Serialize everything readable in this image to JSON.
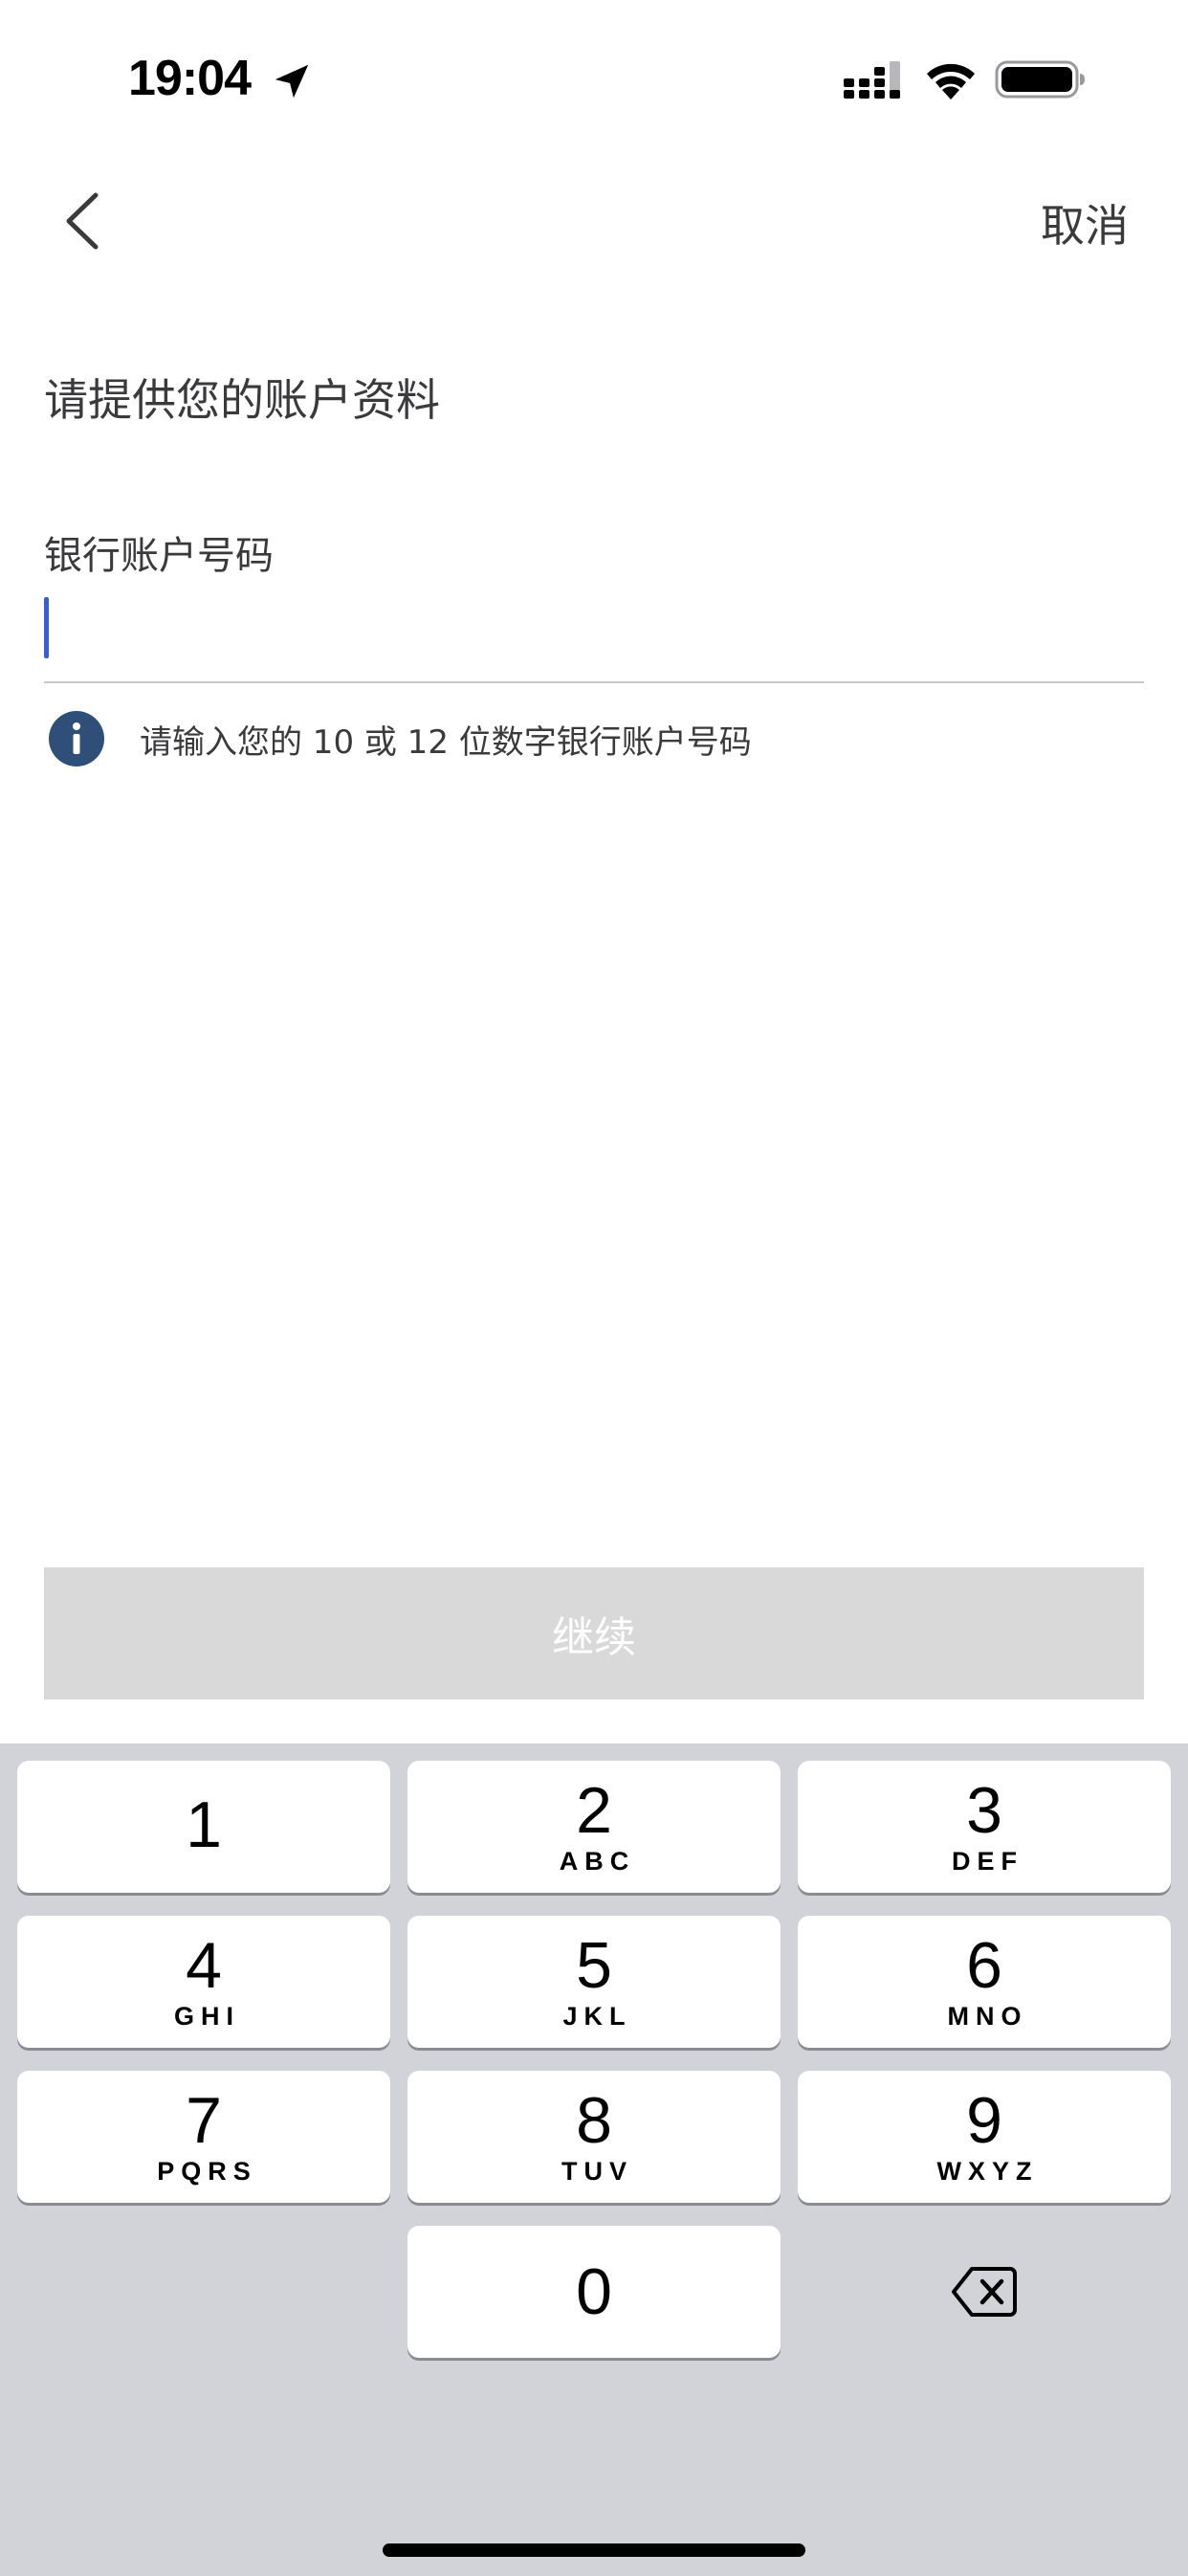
{
  "status_bar": {
    "time": "19:04",
    "icons": [
      "location-arrow-icon",
      "cellular-signal-icon",
      "wifi-icon",
      "battery-icon"
    ]
  },
  "nav": {
    "back_icon": "chevron-left-icon",
    "cancel_label": "取消"
  },
  "form": {
    "title": "请提供您的账户资料",
    "account_field": {
      "label": "银行账户号码",
      "value": "",
      "placeholder": ""
    },
    "hint": {
      "icon": "info-icon",
      "text": "请输入您的 10 或 12 位数字银行账户号码"
    },
    "continue_label": "继续"
  },
  "keypad": {
    "keys": [
      {
        "digit": "1",
        "letters": ""
      },
      {
        "digit": "2",
        "letters": "ABC"
      },
      {
        "digit": "3",
        "letters": "DEF"
      },
      {
        "digit": "4",
        "letters": "GHI"
      },
      {
        "digit": "5",
        "letters": "JKL"
      },
      {
        "digit": "6",
        "letters": "MNO"
      },
      {
        "digit": "7",
        "letters": "PQRS"
      },
      {
        "digit": "8",
        "letters": "TUV"
      },
      {
        "digit": "9",
        "letters": "WXYZ"
      },
      {
        "digit": "0",
        "letters": ""
      }
    ],
    "delete_icon": "backspace-icon"
  },
  "colors": {
    "accent": "#3b5bdb",
    "info_icon": "#2f4f79",
    "continue_disabled_bg": "#d9d9d9",
    "keypad_bg": "#d1d3d9"
  }
}
